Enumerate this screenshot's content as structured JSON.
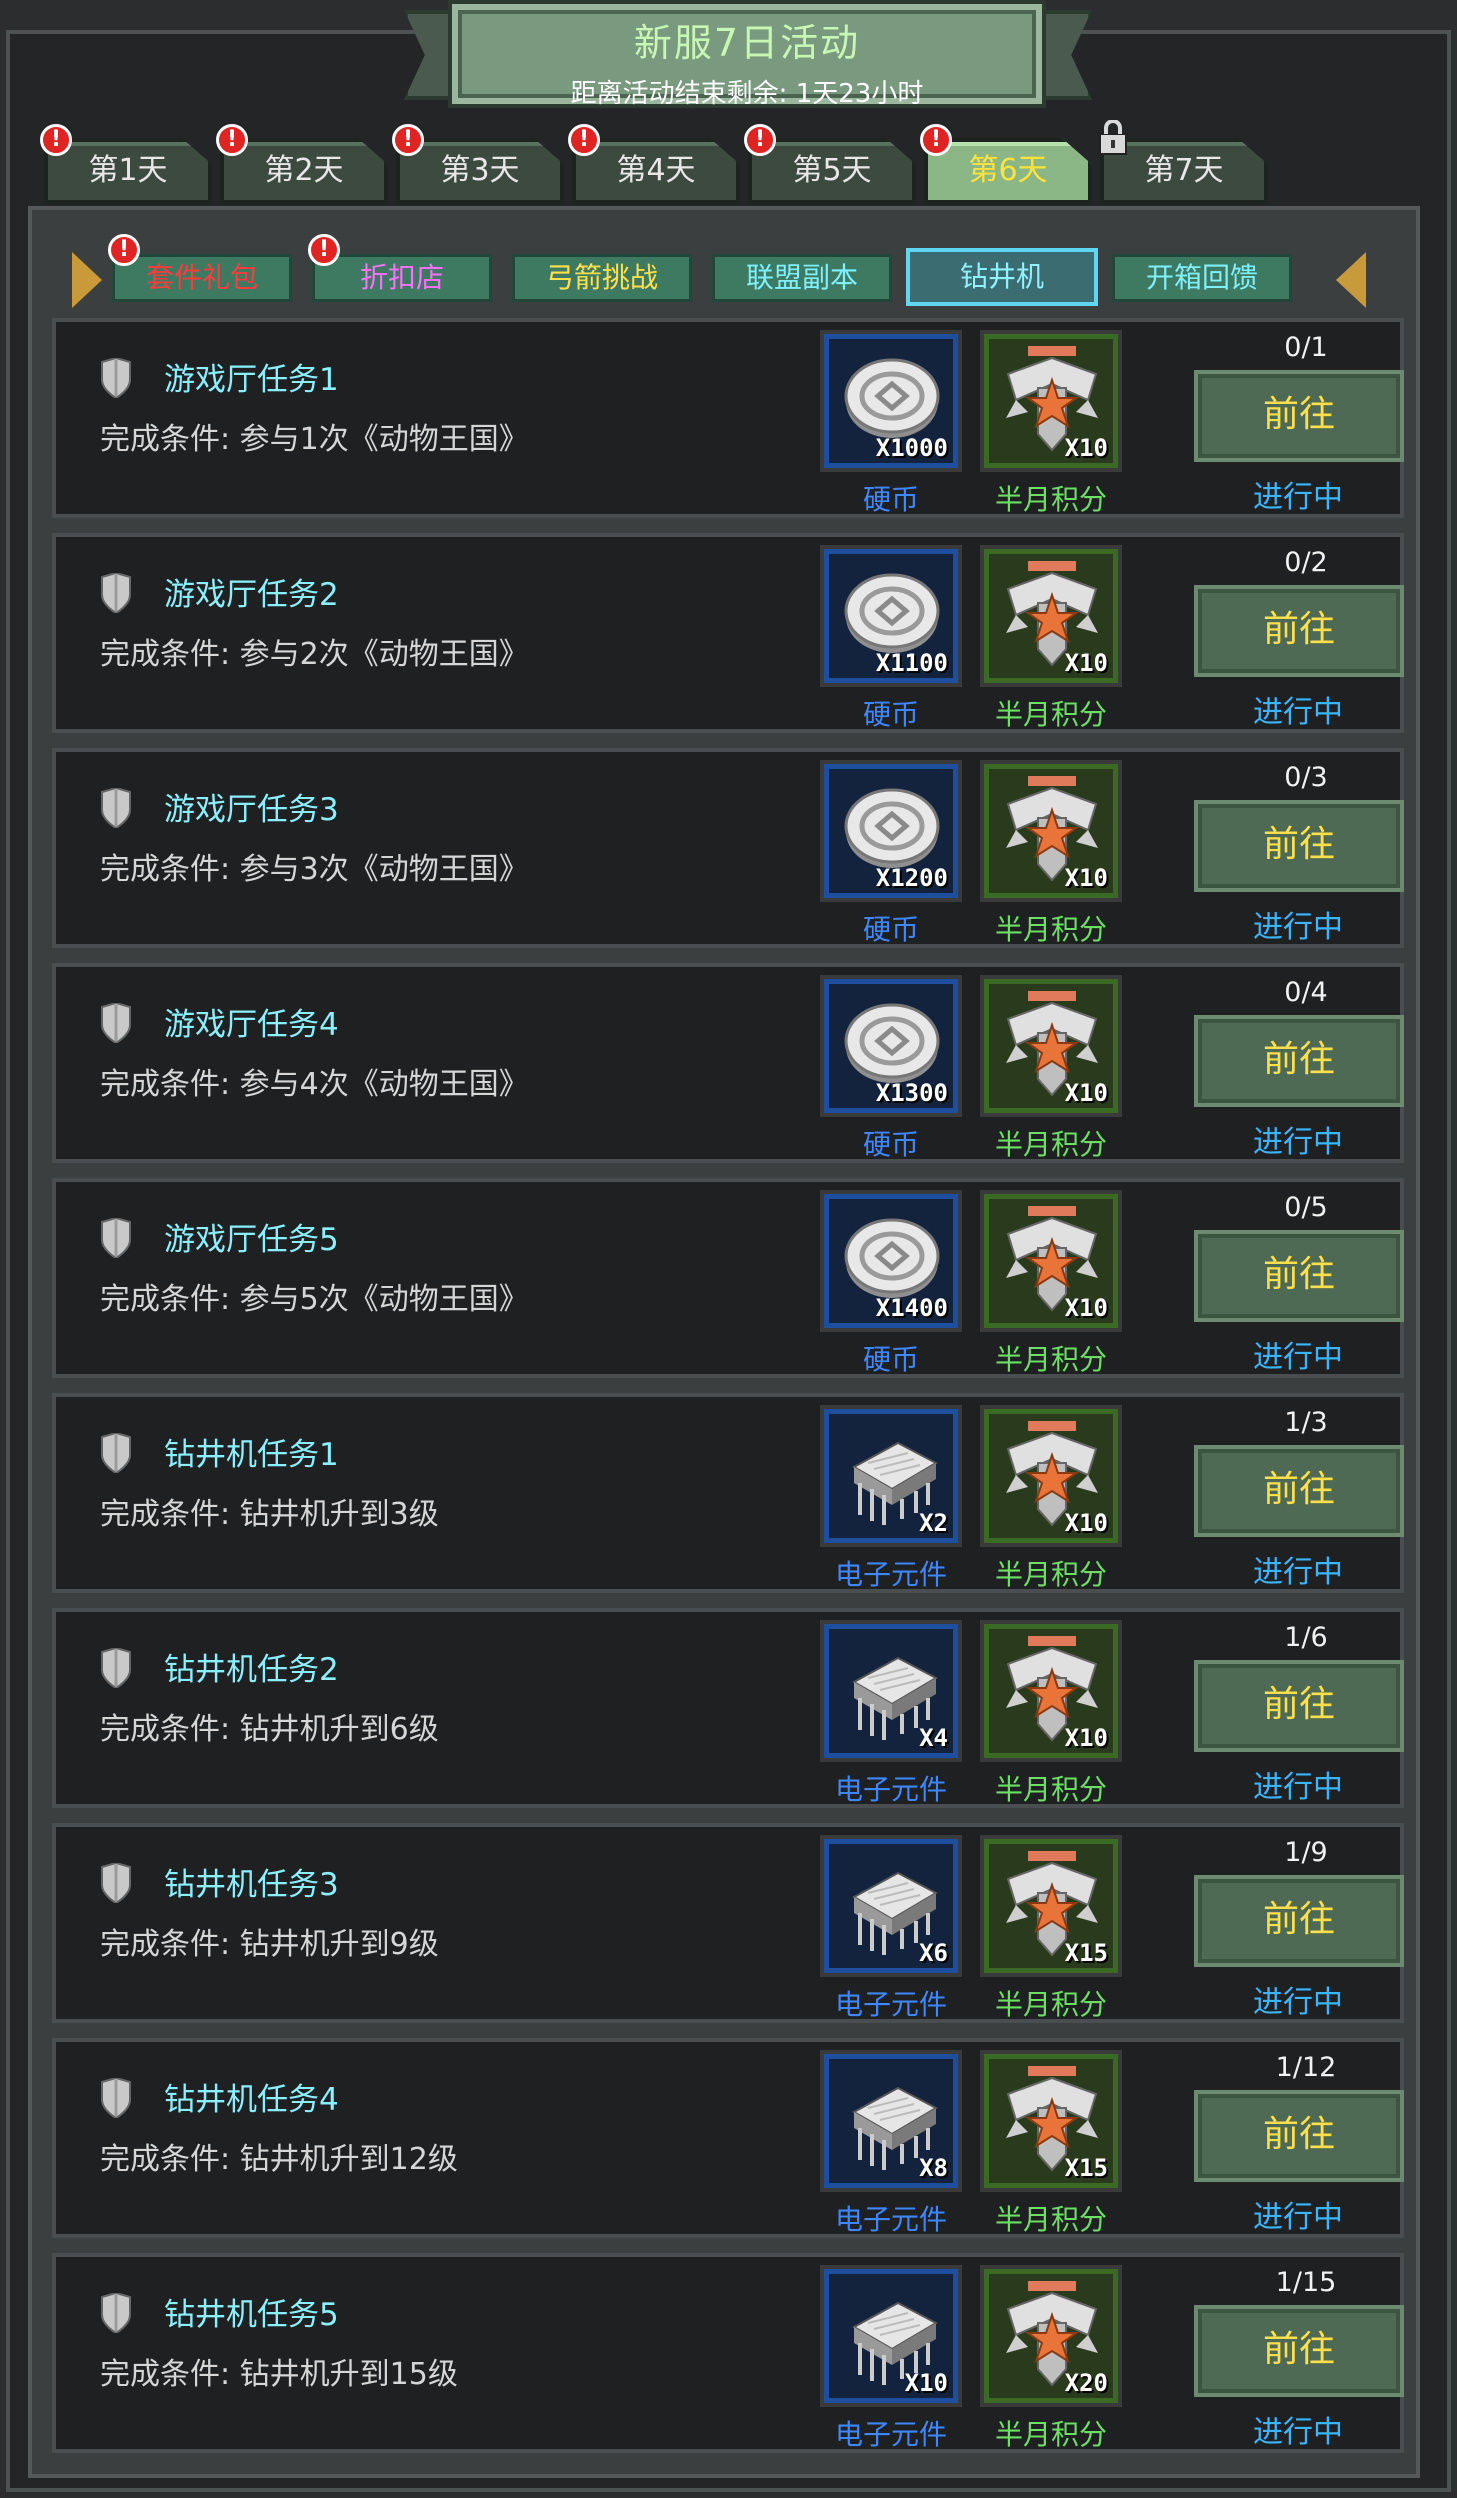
{
  "header": {
    "title": "新服7日活动",
    "countdown": "距离活动结束剩余: 1天23小时"
  },
  "day_tabs": [
    {
      "label": "第1天",
      "badge": "!"
    },
    {
      "label": "第2天",
      "badge": "!"
    },
    {
      "label": "第3天",
      "badge": "!"
    },
    {
      "label": "第4天",
      "badge": "!"
    },
    {
      "label": "第5天",
      "badge": "!"
    },
    {
      "label": "第6天",
      "badge": "!"
    },
    {
      "label": "第7天",
      "badge": ""
    }
  ],
  "category_tabs": [
    {
      "label": "套件礼包",
      "color": "#ff3b3b",
      "badge": "!"
    },
    {
      "label": "折扣店",
      "color": "#ff6fff",
      "badge": "!"
    },
    {
      "label": "弓箭挑战",
      "color": "#ffe04a",
      "badge": ""
    },
    {
      "label": "联盟副本",
      "color": "#7ef0ff",
      "badge": ""
    },
    {
      "label": "钻井机",
      "color": "#8ef3ff",
      "badge": ""
    },
    {
      "label": "开箱回馈",
      "color": "#7ef0ff",
      "badge": ""
    }
  ],
  "tasks": [
    {
      "name": "游戏厅任务1",
      "desc": "完成条件: 参与1次《动物王国》",
      "item1": {
        "icon": "coin-icon",
        "qty": "X1000",
        "label": "硬币"
      },
      "item2": {
        "icon": "eagle-badge-icon",
        "qty": "X10",
        "label": "半月积分"
      },
      "progress": "0/1",
      "button": "前往",
      "status": "进行中"
    },
    {
      "name": "游戏厅任务2",
      "desc": "完成条件: 参与2次《动物王国》",
      "item1": {
        "icon": "coin-icon",
        "qty": "X1100",
        "label": "硬币"
      },
      "item2": {
        "icon": "eagle-badge-icon",
        "qty": "X10",
        "label": "半月积分"
      },
      "progress": "0/2",
      "button": "前往",
      "status": "进行中"
    },
    {
      "name": "游戏厅任务3",
      "desc": "完成条件: 参与3次《动物王国》",
      "item1": {
        "icon": "coin-icon",
        "qty": "X1200",
        "label": "硬币"
      },
      "item2": {
        "icon": "eagle-badge-icon",
        "qty": "X10",
        "label": "半月积分"
      },
      "progress": "0/3",
      "button": "前往",
      "status": "进行中"
    },
    {
      "name": "游戏厅任务4",
      "desc": "完成条件: 参与4次《动物王国》",
      "item1": {
        "icon": "coin-icon",
        "qty": "X1300",
        "label": "硬币"
      },
      "item2": {
        "icon": "eagle-badge-icon",
        "qty": "X10",
        "label": "半月积分"
      },
      "progress": "0/4",
      "button": "前往",
      "status": "进行中"
    },
    {
      "name": "游戏厅任务5",
      "desc": "完成条件: 参与5次《动物王国》",
      "item1": {
        "icon": "coin-icon",
        "qty": "X1400",
        "label": "硬币"
      },
      "item2": {
        "icon": "eagle-badge-icon",
        "qty": "X10",
        "label": "半月积分"
      },
      "progress": "0/5",
      "button": "前往",
      "status": "进行中"
    },
    {
      "name": "钻井机任务1",
      "desc": "完成条件: 钻井机升到3级",
      "item1": {
        "icon": "chip-icon",
        "qty": "X2",
        "label": "电子元件"
      },
      "item2": {
        "icon": "eagle-badge-icon",
        "qty": "X10",
        "label": "半月积分"
      },
      "progress": "1/3",
      "button": "前往",
      "status": "进行中"
    },
    {
      "name": "钻井机任务2",
      "desc": "完成条件: 钻井机升到6级",
      "item1": {
        "icon": "chip-icon",
        "qty": "X4",
        "label": "电子元件"
      },
      "item2": {
        "icon": "eagle-badge-icon",
        "qty": "X10",
        "label": "半月积分"
      },
      "progress": "1/6",
      "button": "前往",
      "status": "进行中"
    },
    {
      "name": "钻井机任务3",
      "desc": "完成条件: 钻井机升到9级",
      "item1": {
        "icon": "chip-icon",
        "qty": "X6",
        "label": "电子元件"
      },
      "item2": {
        "icon": "eagle-badge-icon",
        "qty": "X15",
        "label": "半月积分"
      },
      "progress": "1/9",
      "button": "前往",
      "status": "进行中"
    },
    {
      "name": "钻井机任务4",
      "desc": "完成条件: 钻井机升到12级",
      "item1": {
        "icon": "chip-icon",
        "qty": "X8",
        "label": "电子元件"
      },
      "item2": {
        "icon": "eagle-badge-icon",
        "qty": "X15",
        "label": "半月积分"
      },
      "progress": "1/12",
      "button": "前往",
      "status": "进行中"
    },
    {
      "name": "钻井机任务5",
      "desc": "完成条件: 钻井机升到15级",
      "item1": {
        "icon": "chip-icon",
        "qty": "X10",
        "label": "电子元件"
      },
      "item2": {
        "icon": "eagle-badge-icon",
        "qty": "X20",
        "label": "半月积分"
      },
      "progress": "1/15",
      "button": "前往",
      "status": "进行中"
    }
  ],
  "colors": {
    "accent_active_tab": "#8bb686",
    "task_title": "#8af0ff",
    "button_text": "#ffe04a",
    "status_text": "#39b6ff",
    "blue_label": "#3e87ff",
    "green_label": "#6be063"
  }
}
